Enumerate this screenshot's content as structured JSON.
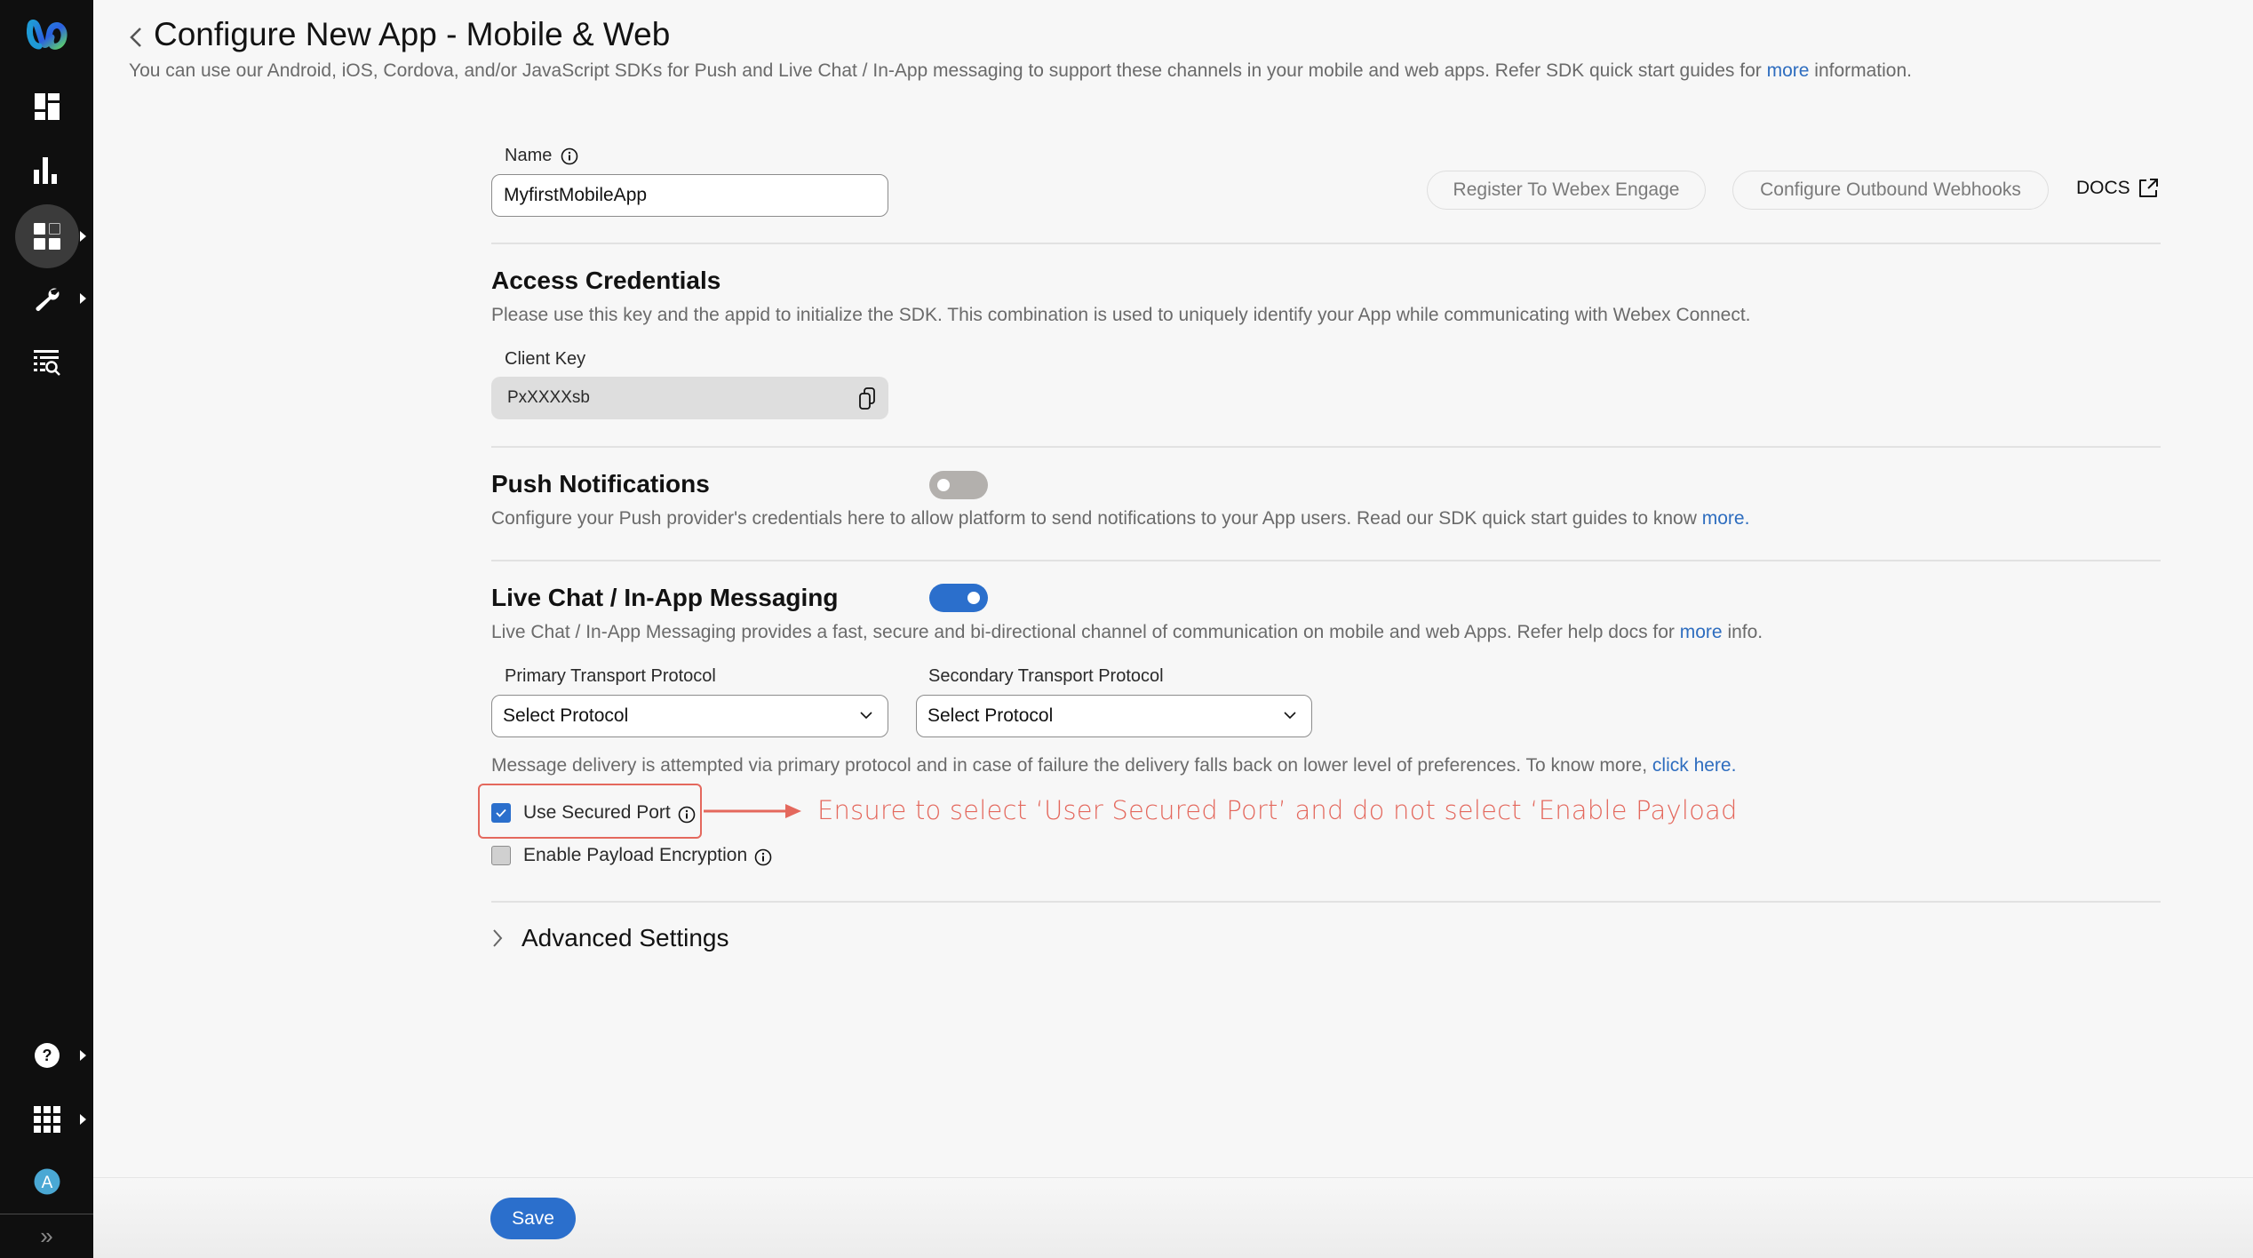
{
  "sidebar": {
    "logo": "webex-logo",
    "items": [
      {
        "name": "dashboard",
        "icon": "dashboard-icon",
        "has_submenu": false,
        "active": false
      },
      {
        "name": "analytics",
        "icon": "bar-chart-icon",
        "has_submenu": false,
        "active": false
      },
      {
        "name": "assets",
        "icon": "apps-grid-icon",
        "has_submenu": true,
        "active": true
      },
      {
        "name": "tools",
        "icon": "wrench-icon",
        "has_submenu": true,
        "active": false
      },
      {
        "name": "logs",
        "icon": "list-search-icon",
        "has_submenu": false,
        "active": false
      }
    ],
    "bottom_items": [
      {
        "name": "help",
        "icon": "help-icon",
        "has_submenu": true
      },
      {
        "name": "app-launcher",
        "icon": "grid-9-icon",
        "has_submenu": true
      },
      {
        "name": "profile",
        "icon": "avatar-icon",
        "avatar_letter": "A"
      }
    ],
    "expand_glyph": "»"
  },
  "header": {
    "title": "Configure New App - Mobile & Web",
    "subtitle_pre": "You can use our Android, iOS, Cordova, and/or JavaScript SDKs for Push and Live Chat / In-App messaging to support these channels in your mobile and web apps. Refer SDK quick start guides for ",
    "subtitle_link": "more",
    "subtitle_post": " information."
  },
  "name_field": {
    "label": "Name",
    "value": "MyfirstMobileApp"
  },
  "actions": {
    "register": "Register To Webex Engage",
    "webhooks": "Configure Outbound Webhooks",
    "docs": "DOCS"
  },
  "access_credentials": {
    "title": "Access Credentials",
    "description": "Please use this key and the appid to initialize the SDK. This combination is used to uniquely identify your App while communicating with Webex Connect.",
    "client_key_label": "Client Key",
    "client_key_value": "PxXXXXsb"
  },
  "push_notifications": {
    "title": "Push Notifications",
    "enabled": false,
    "description_pre": "Configure your Push provider's credentials here to allow platform to send notifications to your App users. Read our SDK quick start guides to know ",
    "description_link": "more."
  },
  "live_chat": {
    "title": "Live Chat / In-App Messaging",
    "enabled": true,
    "description_pre": "Live Chat / In-App Messaging provides a fast, secure and bi-directional channel of communication on mobile and web Apps. Refer help docs for ",
    "description_link": "more",
    "description_post": " info.",
    "primary_label": "Primary Transport Protocol",
    "primary_value": "Select Protocol",
    "secondary_label": "Secondary Transport Protocol",
    "secondary_value": "Select Protocol",
    "delivery_note_pre": "Message delivery is attempted via primary protocol and in case of failure the delivery falls back on lower level of preferences. To know more, ",
    "delivery_note_link": "click here.",
    "use_secured_port": {
      "label": "Use Secured Port",
      "checked": true
    },
    "enable_payload_encryption": {
      "label": "Enable Payload Encryption",
      "checked": false
    }
  },
  "annotation": {
    "text": "Ensure to select ‘User Secured Port’ and do not select ‘Enable Payload",
    "color": "#e4685d"
  },
  "advanced_settings": {
    "label": "Advanced Settings",
    "expanded": false
  },
  "footer": {
    "save_label": "Save"
  },
  "colors": {
    "accent": "#2b6fcc",
    "link": "#2e6dbf",
    "sidebar_bg": "#0f0f0f",
    "annotation": "#e4685d"
  }
}
